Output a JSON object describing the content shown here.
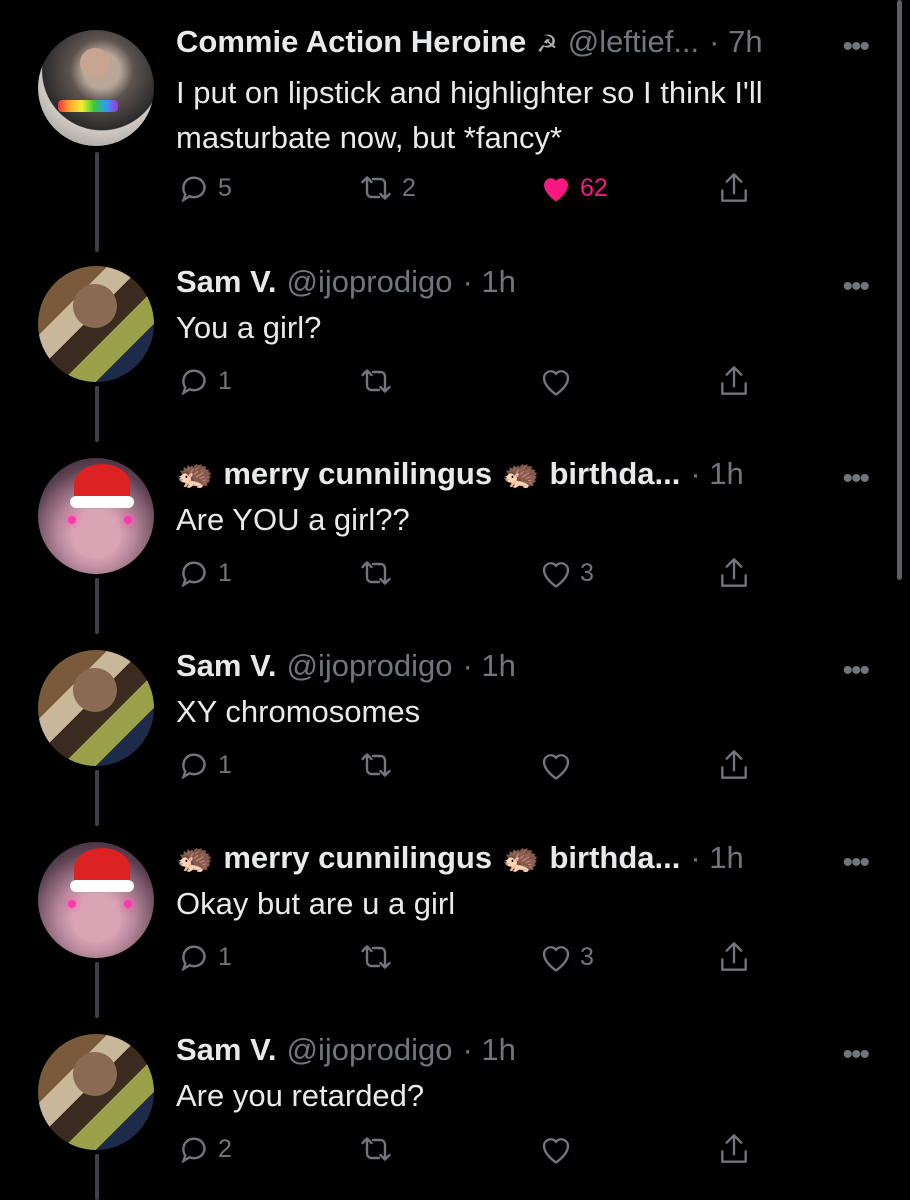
{
  "tweets": [
    {
      "name": "Commie Action Heroine",
      "name_emoji": "☭",
      "handle": "@leftief...",
      "time": "· 7h",
      "text": "I put on lipstick and highlighter so I think I'll masturbate now, but *fancy*",
      "replies": "5",
      "retweets": "2",
      "likes": "62",
      "liked": true
    },
    {
      "name": "Sam V.",
      "handle": "@ijoprodigo",
      "time": "· 1h",
      "text": "You a girl?",
      "replies": "1",
      "retweets": "",
      "likes": ""
    },
    {
      "name_prefix_emoji": "🦔",
      "name": "merry cunnilingus",
      "name_suffix_emoji": "🦔",
      "handle": "birthda...",
      "time": "· 1h",
      "text": "Are YOU a girl??",
      "replies": "1",
      "retweets": "",
      "likes": "3"
    },
    {
      "name": "Sam V.",
      "handle": "@ijoprodigo",
      "time": "· 1h",
      "text": "XY chromosomes",
      "replies": "1",
      "retweets": "",
      "likes": ""
    },
    {
      "name_prefix_emoji": "🦔",
      "name": "merry cunnilingus",
      "name_suffix_emoji": "🦔",
      "handle": "birthda...",
      "time": "· 1h",
      "text": "Okay but are u a girl",
      "replies": "1",
      "retweets": "",
      "likes": "3"
    },
    {
      "name": "Sam V.",
      "handle": "@ijoprodigo",
      "time": "· 1h",
      "text": "Are you retarded?",
      "replies": "2",
      "retweets": "",
      "likes": ""
    }
  ],
  "more_label": "•••",
  "colors": {
    "background": "#000000",
    "muted": "#71767b",
    "like": "#f91880",
    "text": "#e7e9ea"
  }
}
